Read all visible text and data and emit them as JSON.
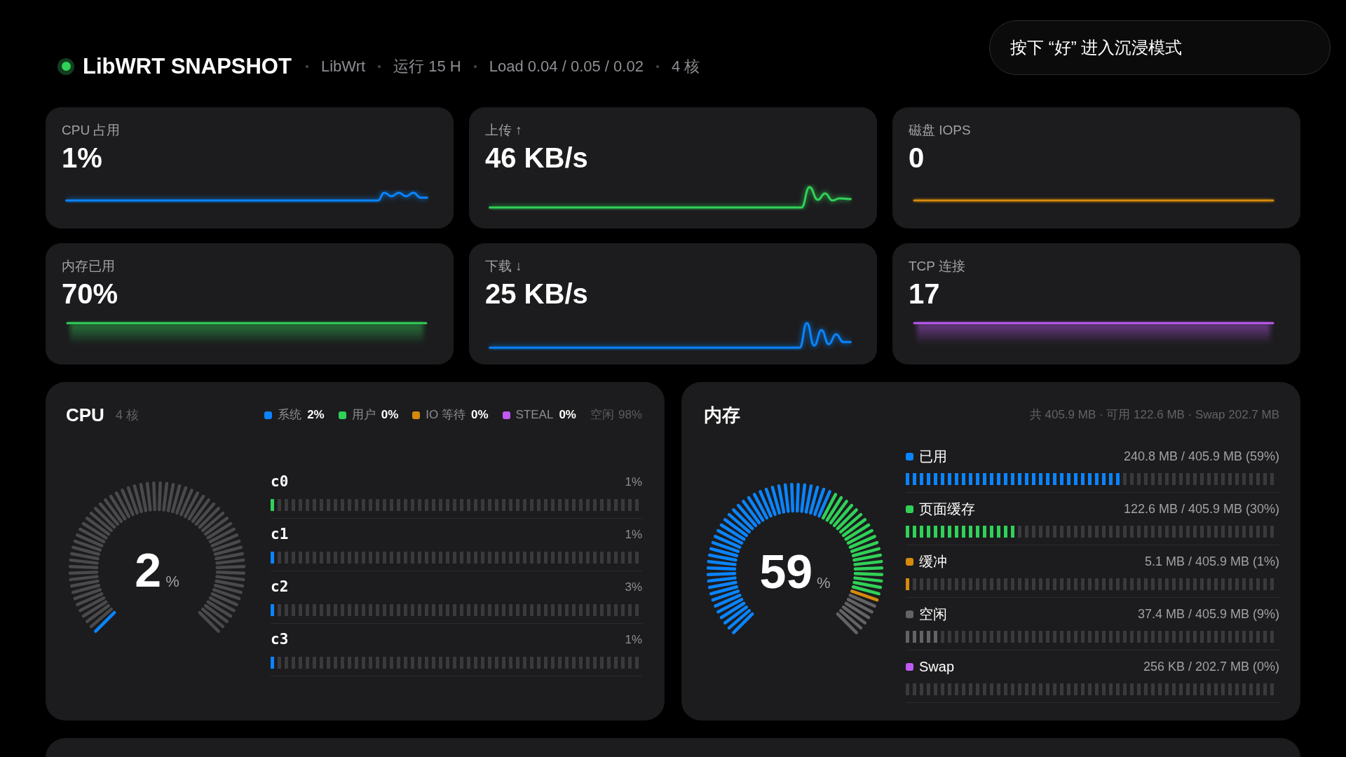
{
  "header": {
    "online": true,
    "title": "LibWRT SNAPSHOT",
    "meta": [
      "LibWrt",
      "运行 15 H",
      "Load 0.04 / 0.05 / 0.02",
      "4 核"
    ]
  },
  "hint": "按下 “好” 进入沉浸模式",
  "stats": [
    {
      "label": "CPU 占用",
      "value": "1%",
      "color": "#0a84ff",
      "kind": "wave"
    },
    {
      "label": "上传 ↑",
      "value": "46 KB/s",
      "color": "#30d158",
      "kind": "wave"
    },
    {
      "label": "磁盘 IOPS",
      "value": "0",
      "color": "#d68a0c",
      "kind": "line"
    },
    {
      "label": "内存已用",
      "value": "70%",
      "color": "#30d158",
      "kind": "band"
    },
    {
      "label": "下载 ↓",
      "value": "25 KB/s",
      "color": "#0a84ff",
      "kind": "wave"
    },
    {
      "label": "TCP 连接",
      "value": "17",
      "color": "#bf5af2",
      "kind": "band"
    }
  ],
  "cpu": {
    "title": "CPU",
    "subtitle": "4 核",
    "legend": [
      {
        "kind": "series",
        "label": "系统",
        "value": "2%",
        "color": "#0a84ff",
        "level": 0.02
      },
      {
        "kind": "series",
        "label": "用户",
        "value": "0%",
        "color": "#30d158",
        "level": 0
      },
      {
        "kind": "series",
        "label": "IO 等待",
        "value": "0%",
        "color": "#d68a0c",
        "level": 0
      },
      {
        "kind": "series",
        "label": "STEAL",
        "value": "0%",
        "color": "#bf5af2",
        "level": 0
      },
      {
        "kind": "idle",
        "label": "空闲",
        "value": "98%"
      }
    ],
    "gauge": {
      "value": "2",
      "unit": "%"
    },
    "cores": [
      {
        "name": "c0",
        "reading": "1%",
        "level": 0.01,
        "color": "#30d158"
      },
      {
        "name": "c1",
        "reading": "1%",
        "level": 0.01,
        "color": "#0a84ff"
      },
      {
        "name": "c2",
        "reading": "3%",
        "level": 0.025,
        "color": "#0a84ff"
      },
      {
        "name": "c3",
        "reading": "1%",
        "level": 0.01,
        "color": "#0a84ff"
      }
    ]
  },
  "memory": {
    "title": "内存",
    "summary": "共 405.9 MB · 可用 122.6 MB · Swap 202.7 MB",
    "gauge": {
      "value": "59",
      "unit": "%"
    },
    "items": [
      {
        "label": "已用",
        "reading": "240.8 MB / 405.9 MB (59%)",
        "color": "#0a84ff",
        "level": 0.593
      },
      {
        "label": "页面缓存",
        "reading": "122.6 MB / 405.9 MB (30%)",
        "color": "#30d158",
        "level": 0.302
      },
      {
        "label": "缓冲",
        "reading": "5.1 MB / 405.9 MB (1%)",
        "color": "#d68a0c",
        "level": 0.013
      },
      {
        "label": "空闲",
        "reading": "37.4 MB / 405.9 MB (9%)",
        "color": "#636366",
        "level": 0.092
      },
      {
        "label": "Swap",
        "reading": "256 KB / 202.7 MB (0%)",
        "color": "#bf5af2",
        "level": 0
      }
    ]
  }
}
